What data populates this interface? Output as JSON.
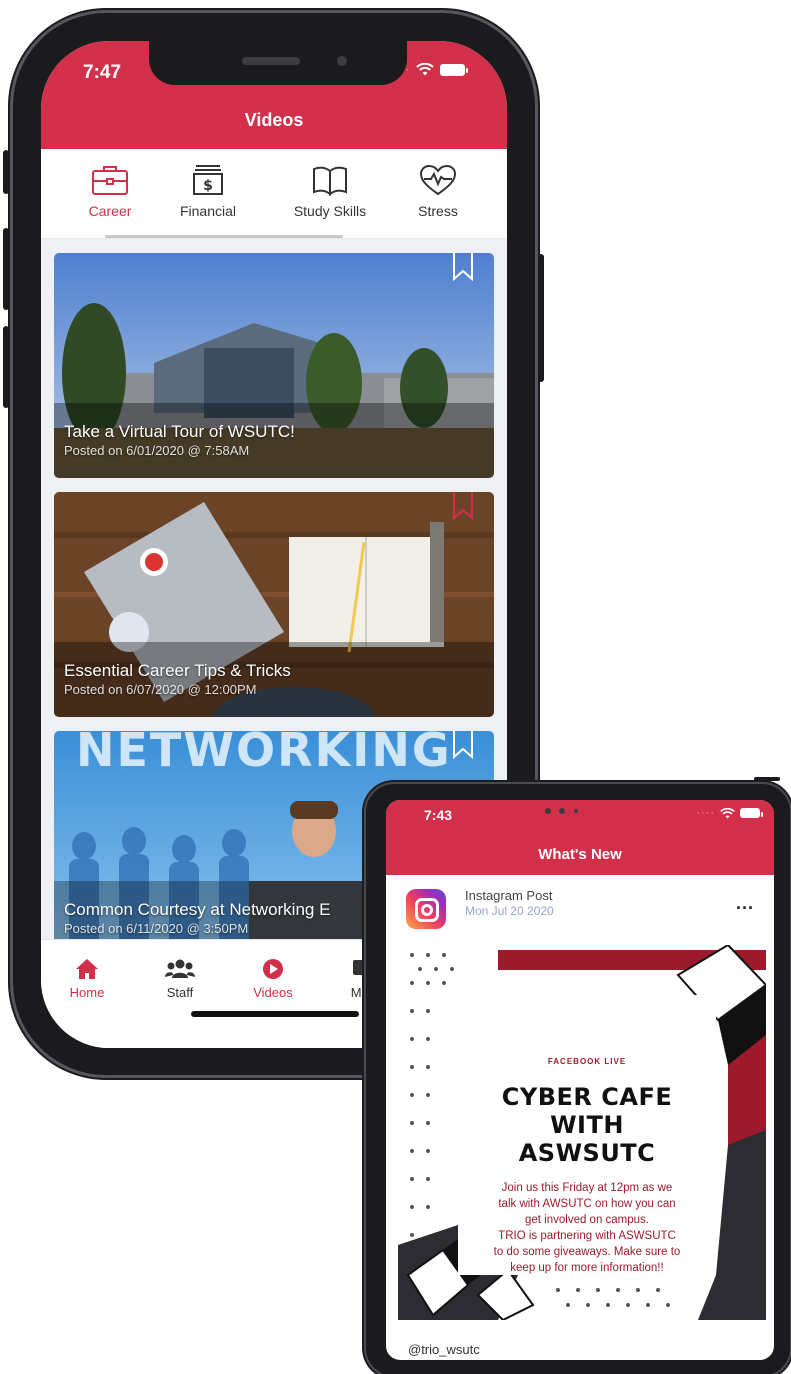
{
  "colors": {
    "accent": "#d12f4a",
    "flyer_red": "#9b1b2c",
    "flyer_dark": "#2e2c33"
  },
  "phone": {
    "status_time": "7:47",
    "title": "Videos",
    "tabs": [
      {
        "label": "Career",
        "icon": "briefcase-icon",
        "active": true
      },
      {
        "label": "Financial",
        "icon": "money-icon",
        "active": false
      },
      {
        "label": "Study Skills",
        "icon": "book-icon",
        "active": false
      },
      {
        "label": "Stress",
        "icon": "heart-pulse-icon",
        "active": false
      }
    ],
    "videos": [
      {
        "title": "Take a Virtual Tour of WSUTC!",
        "date": "Posted on 6/01/2020 @ 7:58AM",
        "bookmarked": false
      },
      {
        "title": "Essential Career Tips & Tricks",
        "date": "Posted on 6/07/2020 @ 12:00PM",
        "bookmarked": true
      },
      {
        "title": "Common Courtesy at Networking E",
        "date": "Posted on 6/11/2020 @ 3:50PM",
        "bookmarked": false,
        "banner": "NETWORKING"
      }
    ],
    "nav": [
      {
        "label": "Home",
        "icon": "home-icon",
        "active": true
      },
      {
        "label": "Staff",
        "icon": "users-icon",
        "active": false
      },
      {
        "label": "Videos",
        "icon": "play-icon",
        "active": true
      },
      {
        "label": "Mes",
        "icon": "message-icon",
        "active": false
      }
    ]
  },
  "tablet": {
    "status_time": "7:43",
    "title": "What's New",
    "post": {
      "type": "Instagram Post",
      "date": "Mon Jul 20 2020",
      "more": "...",
      "handle": "@trio_wsutc",
      "flyer": {
        "label": "FACEBOOK LIVE",
        "title_lines": [
          "CYBER CAFE",
          "WITH",
          "ASWSUTC"
        ],
        "body_lines": [
          "Join us this Friday at 12pm as we",
          "talk with AWSUTC on how you can",
          "get involved on campus.",
          "TRIO is partnering with ASWSUTC",
          "to do some giveaways. Make sure to",
          "keep up for more information!!"
        ]
      }
    }
  }
}
